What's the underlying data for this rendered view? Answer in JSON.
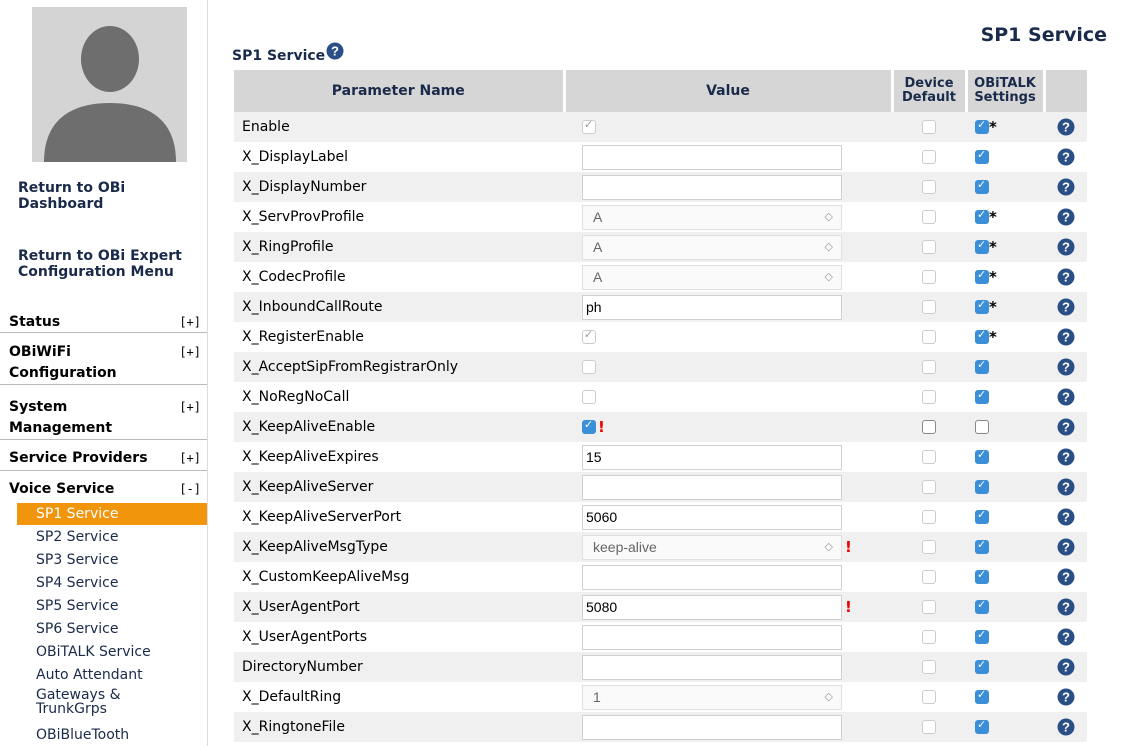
{
  "sidebar": {
    "links": [
      "Return to OBi Dashboard",
      "Return to OBi Expert Configuration Menu"
    ],
    "sections": [
      {
        "label": "Status",
        "toggle": "[+]"
      },
      {
        "label": "OBiWiFi Configuration",
        "toggle": "[+]"
      },
      {
        "label": "System Management",
        "toggle": "[+]"
      },
      {
        "label": "Service Providers",
        "toggle": "[+]"
      },
      {
        "label": "Voice Service",
        "toggle": "[-]"
      }
    ],
    "voice_items": [
      "SP1 Service",
      "SP2 Service",
      "SP3 Service",
      "SP4 Service",
      "SP5 Service",
      "SP6 Service",
      "OBiTALK Service",
      "Auto Attendant",
      "Gateways & TrunkGrps",
      "OBiBlueTooth"
    ],
    "active_item": "SP1 Service"
  },
  "header": {
    "title": "SP1 Service"
  },
  "section_title": "SP1 Service",
  "table": {
    "headers": [
      "Parameter Name",
      "Value",
      "Device Default",
      "OBiTALK Settings"
    ],
    "rows": [
      {
        "name": "Enable",
        "value_type": "checkbox-disabled-checked",
        "value": "",
        "warn": false,
        "device_default": "off",
        "obitalk": "on",
        "star": true
      },
      {
        "name": "X_DisplayLabel",
        "value_type": "text",
        "value": "",
        "warn": false,
        "device_default": "off",
        "obitalk": "on",
        "star": false
      },
      {
        "name": "X_DisplayNumber",
        "value_type": "text",
        "value": "",
        "warn": false,
        "device_default": "off",
        "obitalk": "on",
        "star": false
      },
      {
        "name": "X_ServProvProfile",
        "value_type": "select",
        "value": "A",
        "warn": false,
        "device_default": "off",
        "obitalk": "on",
        "star": true
      },
      {
        "name": "X_RingProfile",
        "value_type": "select",
        "value": "A",
        "warn": false,
        "device_default": "off",
        "obitalk": "on",
        "star": true
      },
      {
        "name": "X_CodecProfile",
        "value_type": "select",
        "value": "A",
        "warn": false,
        "device_default": "off",
        "obitalk": "on",
        "star": true
      },
      {
        "name": "X_InboundCallRoute",
        "value_type": "text",
        "value": "ph",
        "warn": false,
        "device_default": "off",
        "obitalk": "on",
        "star": true
      },
      {
        "name": "X_RegisterEnable",
        "value_type": "checkbox-disabled-checked",
        "value": "",
        "warn": false,
        "device_default": "off",
        "obitalk": "on",
        "star": true
      },
      {
        "name": "X_AcceptSipFromRegistrarOnly",
        "value_type": "checkbox-disabled",
        "value": "",
        "warn": false,
        "device_default": "off",
        "obitalk": "on",
        "star": false
      },
      {
        "name": "X_NoRegNoCall",
        "value_type": "checkbox-disabled",
        "value": "",
        "warn": false,
        "device_default": "off",
        "obitalk": "on",
        "star": false
      },
      {
        "name": "X_KeepAliveEnable",
        "value_type": "checkbox-checked",
        "value": "",
        "warn": true,
        "device_default": "off-active",
        "obitalk": "off",
        "star": false
      },
      {
        "name": "X_KeepAliveExpires",
        "value_type": "text",
        "value": "15",
        "warn": false,
        "device_default": "off",
        "obitalk": "on",
        "star": false
      },
      {
        "name": "X_KeepAliveServer",
        "value_type": "text",
        "value": "",
        "warn": false,
        "device_default": "off",
        "obitalk": "on",
        "star": false
      },
      {
        "name": "X_KeepAliveServerPort",
        "value_type": "text",
        "value": "5060",
        "warn": false,
        "device_default": "off",
        "obitalk": "on",
        "star": false
      },
      {
        "name": "X_KeepAliveMsgType",
        "value_type": "select",
        "value": "keep-alive",
        "warn": true,
        "device_default": "off",
        "obitalk": "on",
        "star": false
      },
      {
        "name": "X_CustomKeepAliveMsg",
        "value_type": "text",
        "value": "",
        "warn": false,
        "device_default": "off",
        "obitalk": "on",
        "star": false
      },
      {
        "name": "X_UserAgentPort",
        "value_type": "text",
        "value": "5080",
        "warn": true,
        "device_default": "off",
        "obitalk": "on",
        "star": false
      },
      {
        "name": "X_UserAgentPorts",
        "value_type": "text",
        "value": "",
        "warn": false,
        "device_default": "off",
        "obitalk": "on",
        "star": false
      },
      {
        "name": "DirectoryNumber",
        "value_type": "text",
        "value": "",
        "warn": false,
        "device_default": "off",
        "obitalk": "on",
        "star": false
      },
      {
        "name": "X_DefaultRing",
        "value_type": "select",
        "value": "1",
        "warn": false,
        "device_default": "off",
        "obitalk": "on",
        "star": false
      },
      {
        "name": "X_RingtoneFile",
        "value_type": "text",
        "value": "",
        "warn": false,
        "device_default": "off",
        "obitalk": "on",
        "star": false
      }
    ]
  },
  "icons": {
    "help": "help-question-icon",
    "avatar": "user-avatar-icon",
    "select_arrows": "select-arrows-icon"
  },
  "symbols": {
    "warn": "!",
    "star": "*",
    "select_arrows": "◇"
  },
  "colors": {
    "accent": "#f0950c",
    "header_bg": "#d6d6d6",
    "checkbox_blue": "#3b8fd9",
    "warning": "#e00000",
    "text_dark": "#1a2a4a"
  }
}
